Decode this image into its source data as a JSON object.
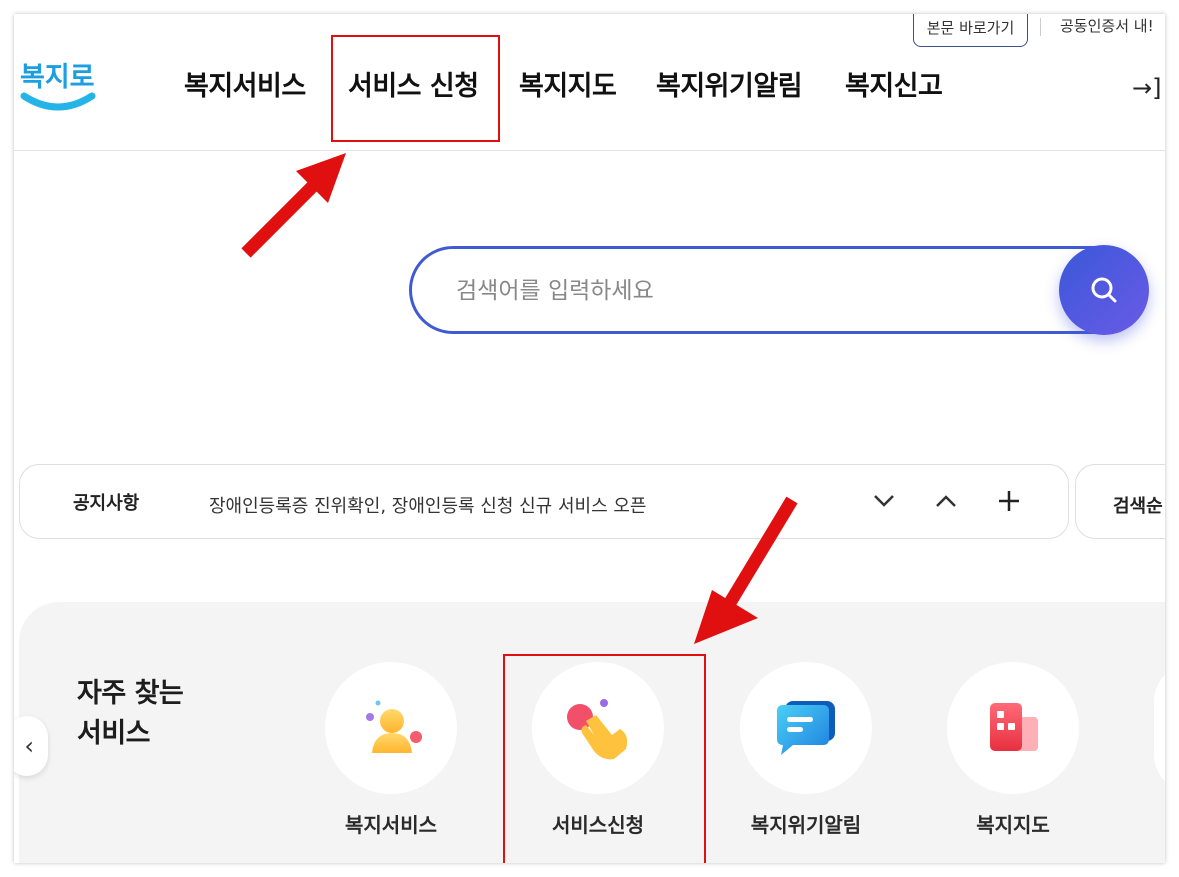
{
  "utility": {
    "skip_link": "본문 바로가기",
    "cert_link": "공동인증서 내!"
  },
  "logo": {
    "text": "복지로"
  },
  "gnb": {
    "items": [
      {
        "label": "복지서비스"
      },
      {
        "label": "서비스 신청"
      },
      {
        "label": "복지지도"
      },
      {
        "label": "복지위기알림"
      },
      {
        "label": "복지신고"
      }
    ],
    "login_glyph": "→]"
  },
  "search": {
    "placeholder": "검색어를 입력하세요",
    "icon": "search-icon"
  },
  "notice": {
    "title": "공지사항",
    "text": "장애인등록증 진위확인, 장애인등록 신청 신규 서비스 오픈",
    "side_label": "검색순"
  },
  "quick": {
    "title_line1": "자주 찾는",
    "title_line2": "서비스",
    "prev_glyph": "‹",
    "items": [
      {
        "label": "복지서비스",
        "icon": "person-icon"
      },
      {
        "label": "서비스신청",
        "icon": "hand-tap-icon"
      },
      {
        "label": "복지위기알림",
        "icon": "chat-bubble-icon"
      },
      {
        "label": "복지지도",
        "icon": "building-icon"
      }
    ]
  },
  "colors": {
    "accent_blue": "#3f5bd4",
    "annotation_red": "#e01010",
    "logo_blue": "#1b9fe0"
  }
}
